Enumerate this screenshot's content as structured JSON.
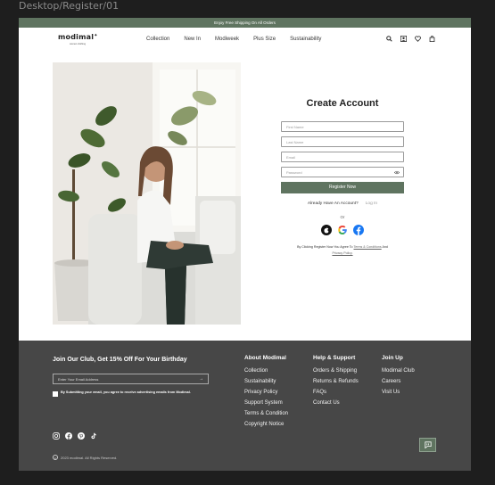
{
  "frame_label": "Desktop/Register/01",
  "promo_text": "Enjoy Free Shipping On All Orders",
  "brand": {
    "name": "modimal",
    "tagline": "women clothing"
  },
  "nav": {
    "items": [
      "Collection",
      "New In",
      "Modiweek",
      "Plus Size",
      "Sustainability"
    ]
  },
  "nav_icons": [
    "search-icon",
    "user-icon",
    "heart-icon",
    "bag-icon"
  ],
  "form": {
    "title": "Create Account",
    "first_name_placeholder": "First Name",
    "last_name_placeholder": "Last Name",
    "email_placeholder": "Email",
    "password_placeholder": "Password",
    "register_label": "Register Now",
    "already_text": "Already Have An Account?",
    "login_label": "Log In",
    "or_text": "Or",
    "terms_prefix": "By Clicking Register Now You Agree To",
    "terms_link": "Terms & Conditions",
    "terms_and": "And",
    "privacy_link": "Privacy Policy."
  },
  "footer": {
    "newsletter_title": "Join Our Club, Get 15% Off For Your Birthday",
    "email_placeholder": "Enter Your Email Address",
    "consent": "By Submitting your email, you agree to receive advertising emails from Modimal.",
    "copyright": "2023 modimal. All Rights Reserved.",
    "columns": [
      {
        "title": "About Modimal",
        "items": [
          "Collection",
          "Sustainability",
          "Privacy Policy",
          "Support System",
          "Terms & Condition",
          "Copyright Notice"
        ]
      },
      {
        "title": "Help & Support",
        "items": [
          "Orders & Shipping",
          "Returns & Refunds",
          "FAQs",
          "Contact Us"
        ]
      },
      {
        "title": "Join Up",
        "items": [
          "Modimal Club",
          "Careers",
          "Visit Us"
        ]
      }
    ]
  },
  "colors": {
    "accent": "#5f7460",
    "footer_bg": "#474747",
    "canvas": "#1e1e1e"
  }
}
